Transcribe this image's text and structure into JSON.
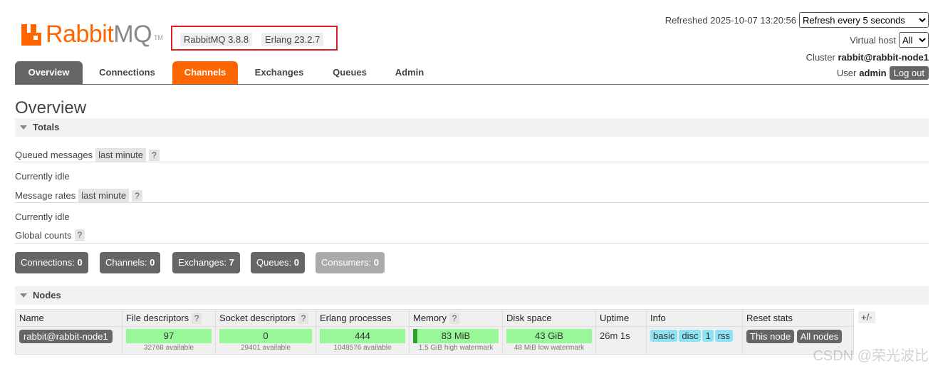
{
  "logo": {
    "word_a": "Rabbit",
    "word_b": "MQ",
    "tm": "TM"
  },
  "versions": {
    "rabbitmq": "RabbitMQ 3.8.8",
    "erlang": "Erlang 23.2.7"
  },
  "header": {
    "refreshed_label": "Refreshed 2025-10-07 13:20:56",
    "refresh_select": "Refresh every 5 seconds",
    "vhost_label": "Virtual host",
    "vhost_select": "All",
    "cluster_label": "Cluster",
    "cluster_name": "rabbit@rabbit-node1",
    "user_label": "User",
    "user_name": "admin",
    "logout": "Log out"
  },
  "nav": {
    "tabs": [
      "Overview",
      "Connections",
      "Channels",
      "Exchanges",
      "Queues",
      "Admin"
    ]
  },
  "page_title": "Overview",
  "totals": {
    "title": "Totals",
    "queued_label": "Queued messages",
    "queued_range": "last minute",
    "help": "?",
    "idle1": "Currently idle",
    "rates_label": "Message rates",
    "rates_range": "last minute",
    "idle2": "Currently idle",
    "global_label": "Global counts",
    "counts": [
      {
        "label": "Connections:",
        "value": "0"
      },
      {
        "label": "Channels:",
        "value": "0"
      },
      {
        "label": "Exchanges:",
        "value": "7"
      },
      {
        "label": "Queues:",
        "value": "0"
      },
      {
        "label": "Consumers:",
        "value": "0"
      }
    ]
  },
  "nodes": {
    "title": "Nodes",
    "plusminus": "+/-",
    "headers": [
      "Name",
      "File descriptors",
      "Socket descriptors",
      "Erlang processes",
      "Memory",
      "Disk space",
      "Uptime",
      "Info",
      "Reset stats"
    ],
    "row": {
      "name": "rabbit@rabbit-node1",
      "fd": {
        "value": "97",
        "sub": "32768 available"
      },
      "sockets": {
        "value": "0",
        "sub": "29401 available"
      },
      "procs": {
        "value": "444",
        "sub": "1048576 available"
      },
      "memory": {
        "value": "83 MiB",
        "sub": "1.5 GiB high watermark"
      },
      "disk": {
        "value": "43 GiB",
        "sub": "48 MiB low watermark"
      },
      "uptime": "26m 1s",
      "info": [
        "basic",
        "disc",
        "1",
        "rss"
      ],
      "reset": [
        "This node",
        "All nodes"
      ]
    }
  },
  "colors": {
    "accent": "#ff6600",
    "bar_green": "#98f898",
    "bar_green_dark": "#2da02d",
    "info_blue": "#8de3f5",
    "highlight_red": "#e01b24"
  },
  "watermark": "CSDN @荣光波比"
}
